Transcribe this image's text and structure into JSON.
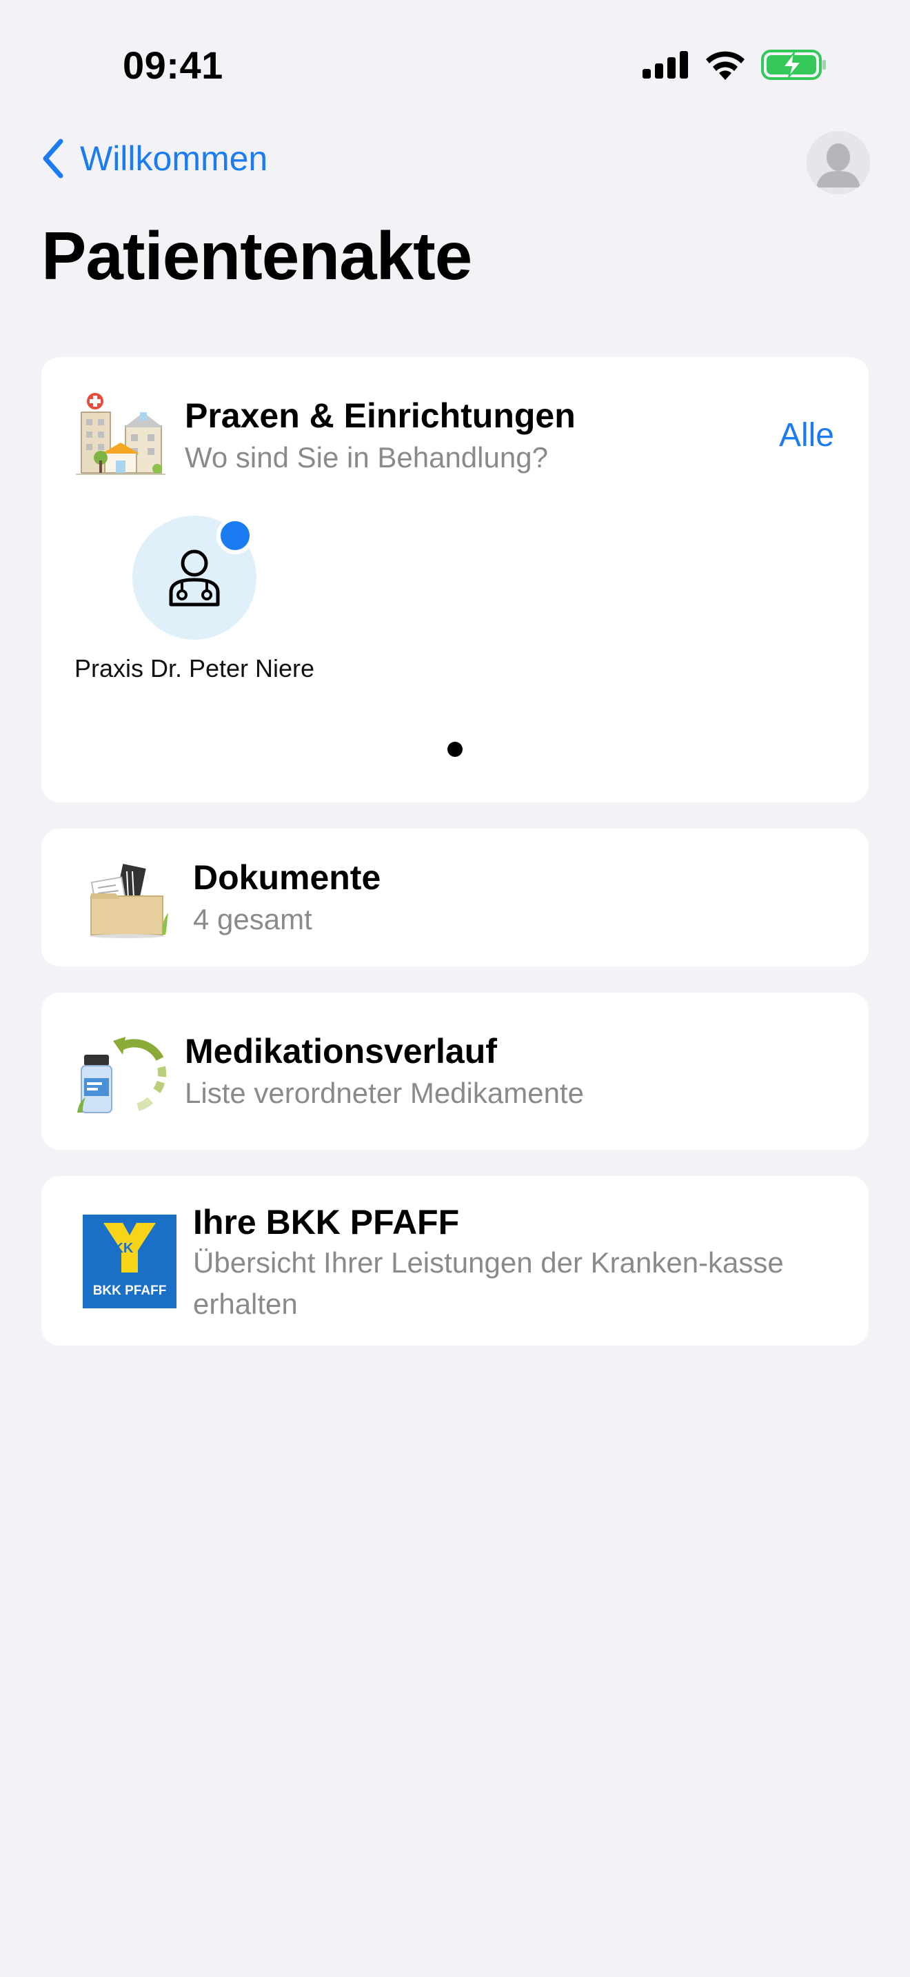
{
  "status_bar": {
    "time": "09:41"
  },
  "nav": {
    "back_label": "Willkommen"
  },
  "page": {
    "title": "Patientenakte"
  },
  "practices": {
    "title": "Praxen & Einrichtungen",
    "subtitle": "Wo sind Sie in Behandlung?",
    "all_label": "Alle",
    "items": [
      {
        "name": "Praxis Dr. Peter Niere",
        "unread": true
      }
    ]
  },
  "documents": {
    "title": "Dokumente",
    "subtitle": "4 gesamt"
  },
  "medication": {
    "title": "Medikationsverlauf",
    "subtitle": "Liste verordneter Medikamente"
  },
  "insurance": {
    "title": "Ihre BKK PFAFF",
    "subtitle": "Übersicht Ihrer Leistungen der Kranken-kasse erhalten",
    "logo_top": "BKK",
    "logo_bottom": "BKK PFAFF"
  },
  "colors": {
    "accent": "#1a7cf0",
    "background": "#f2f2f7",
    "battery": "#34c759"
  }
}
